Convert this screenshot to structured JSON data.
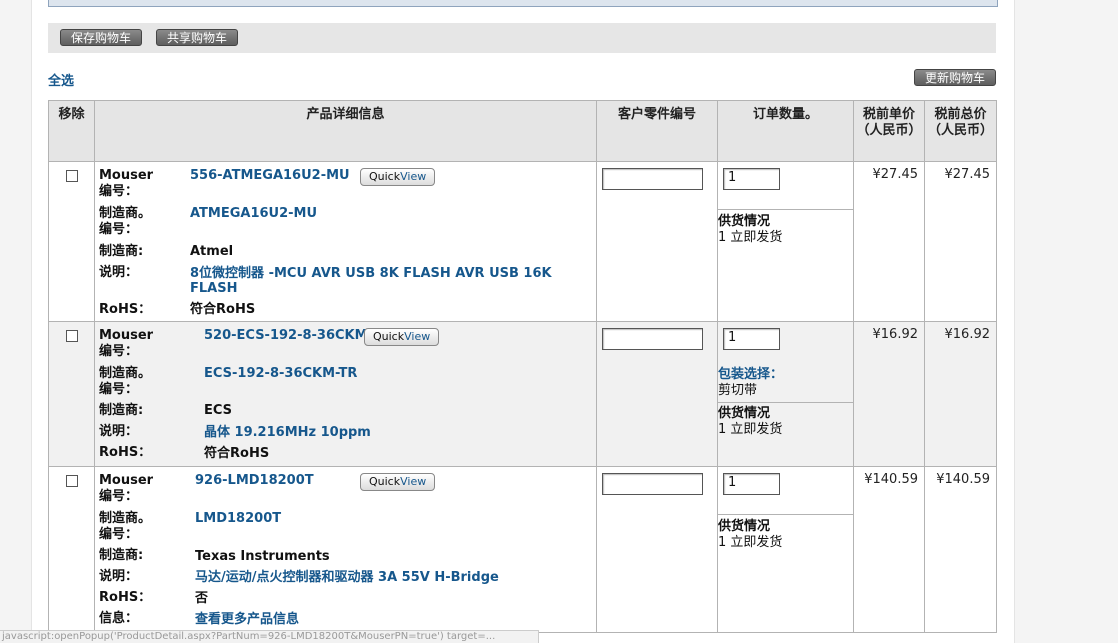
{
  "toolbar": {
    "save_cart": "保存购物车",
    "share_cart": "共享购物车",
    "update_cart": "更新购物车"
  },
  "select_all": "全选",
  "columns": {
    "remove": "移除",
    "details": "产品详细信息",
    "customer_part": "客户零件编号",
    "quantity": "订单数量。",
    "unit_price": "税前单价（人民币）",
    "ext_price": "税前总价（人民币）"
  },
  "labels": {
    "mouser_no": "Mouser 编号：",
    "mfr_no": "制造商。 编号：",
    "mfr": "制造商:",
    "desc": "说明：",
    "rohs": "RoHS：",
    "more_info": "信息："
  },
  "quickview": {
    "quick": "Quick",
    "view": "View"
  },
  "availability_label": "供货情况",
  "packaging_label": "包装选择：",
  "items": [
    {
      "mouser_no": "556-ATMEGA16U2-MU",
      "mfr_no": "ATMEGA16U2-MU",
      "mfr": "Atmel",
      "desc": "8位微控制器 -MCU AVR USB 8K FLASH AVR USB 16K FLASH",
      "rohs": "符合RoHS",
      "customer_part": "",
      "qty": "1",
      "availability": "1 立即发货",
      "unit_price": "¥27.45",
      "ext_price": "¥27.45"
    },
    {
      "mouser_no": "520-ECS-192-8-36CKM",
      "mfr_no": "ECS-192-8-36CKM-TR",
      "mfr": "ECS",
      "desc": "晶体 19.216MHz 10ppm",
      "rohs": "符合RoHS",
      "customer_part": "",
      "qty": "1",
      "packaging": "剪切带",
      "availability": "1 立即发货",
      "unit_price": "¥16.92",
      "ext_price": "¥16.92"
    },
    {
      "mouser_no": "926-LMD18200T",
      "mfr_no": "LMD18200T",
      "mfr": "Texas Instruments",
      "desc": "马达/运动/点火控制器和驱动器 3A 55V H-Bridge",
      "rohs": "否",
      "more_info": "查看更多产品信息",
      "customer_part": "",
      "qty": "1",
      "availability": "1 立即发货",
      "unit_price": "¥140.59",
      "ext_price": "¥140.59"
    }
  ],
  "status_bar": "javascript:openPopup('ProductDetail.aspx?PartNum=926-LMD18200T&MouserPN=true') target=..."
}
